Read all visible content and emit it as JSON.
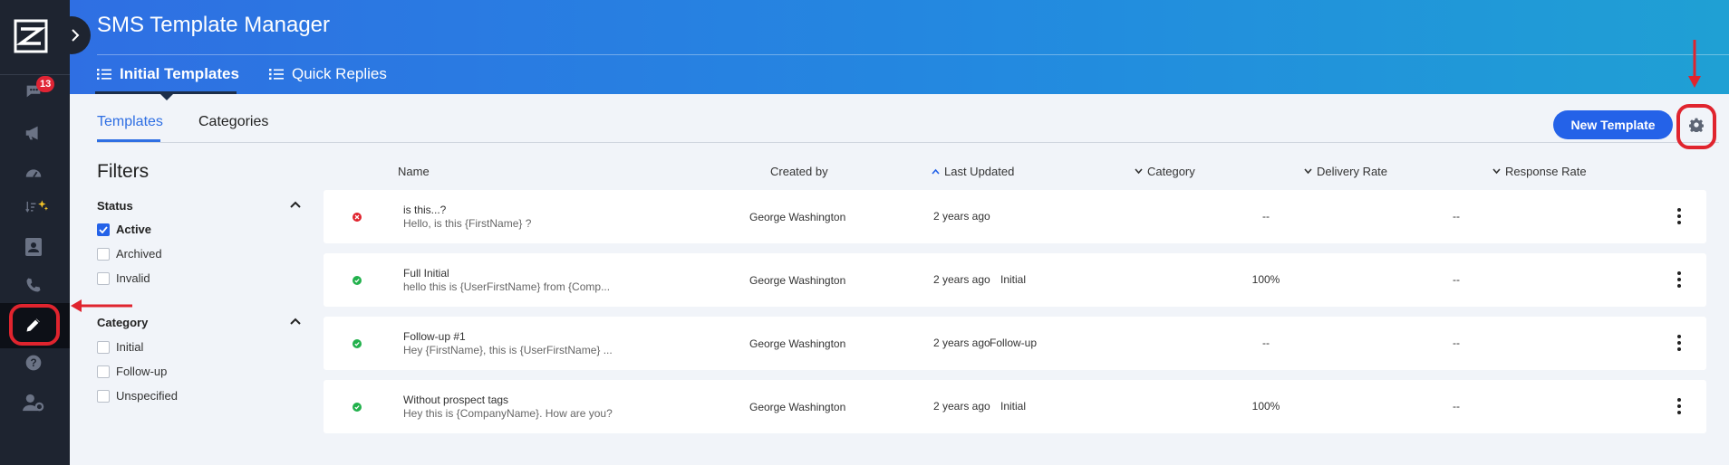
{
  "app": {
    "title": "SMS Template Manager"
  },
  "sidebar": {
    "badge_count": "13",
    "items": [
      {
        "icon": "chat-icon"
      },
      {
        "icon": "megaphone-icon"
      },
      {
        "icon": "gauge-icon"
      },
      {
        "icon": "sort-sparkle-icon"
      },
      {
        "icon": "contact-card-icon"
      },
      {
        "icon": "phone-icon"
      },
      {
        "icon": "pencil-icon",
        "active": true
      },
      {
        "icon": "help-icon"
      },
      {
        "icon": "user-settings-icon"
      }
    ]
  },
  "top_tabs": [
    {
      "label": "Initial Templates",
      "active": true
    },
    {
      "label": "Quick Replies",
      "active": false
    }
  ],
  "sub_tabs": [
    {
      "label": "Templates",
      "active": true
    },
    {
      "label": "Categories",
      "active": false
    }
  ],
  "actions": {
    "new_template_label": "New Template"
  },
  "filters": {
    "title": "Filters",
    "status": {
      "heading": "Status",
      "options": [
        {
          "label": "Active",
          "checked": true
        },
        {
          "label": "Archived",
          "checked": false
        },
        {
          "label": "Invalid",
          "checked": false
        }
      ]
    },
    "category": {
      "heading": "Category",
      "options": [
        {
          "label": "Initial",
          "checked": false
        },
        {
          "label": "Follow-up",
          "checked": false
        },
        {
          "label": "Unspecified",
          "checked": false
        }
      ]
    }
  },
  "table": {
    "columns": {
      "name": "Name",
      "created_by": "Created by",
      "last_updated": "Last Updated",
      "category": "Category",
      "delivery_rate": "Delivery Rate",
      "response_rate": "Response Rate"
    },
    "rows": [
      {
        "status": "invalid",
        "title": "is this...?",
        "preview": "Hello, is this {FirstName} ?",
        "created_by": "George Washington",
        "last_updated": "2 years ago",
        "category": "",
        "delivery_rate": "--",
        "response_rate": "--"
      },
      {
        "status": "active",
        "title": "Full Initial",
        "preview": "hello this is {UserFirstName} from {Comp...",
        "created_by": "George Washington",
        "last_updated": "2 years ago",
        "category": "Initial",
        "delivery_rate": "100%",
        "response_rate": "--"
      },
      {
        "status": "active",
        "title": "Follow-up #1",
        "preview": "Hey {FirstName}, this is {UserFirstName} ...",
        "created_by": "George Washington",
        "last_updated": "2 years ago",
        "category": "Follow-up",
        "delivery_rate": "--",
        "response_rate": "--"
      },
      {
        "status": "active",
        "title": "Without prospect tags",
        "preview": "Hey this is {CompanyName}. How are you?",
        "created_by": "George Washington",
        "last_updated": "2 years ago",
        "category": "Initial",
        "delivery_rate": "100%",
        "response_rate": "--"
      }
    ]
  },
  "colors": {
    "accent": "#2462e8",
    "annotation_red": "#e0242e",
    "status_active": "#22b14c",
    "status_invalid": "#e0242e",
    "sidebar_bg": "#1e2430"
  }
}
